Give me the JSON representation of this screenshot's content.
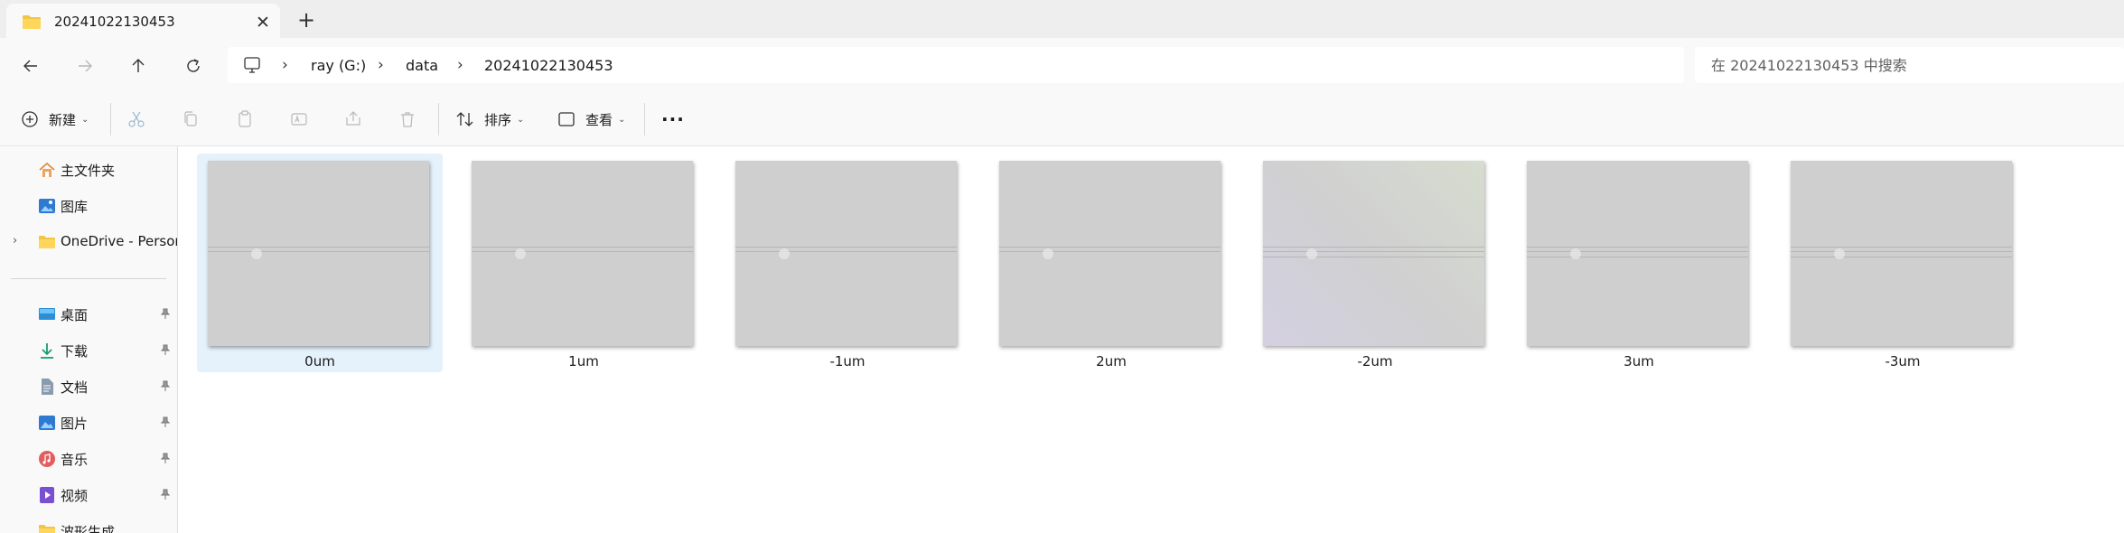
{
  "tab": {
    "title": "20241022130453",
    "close_glyph": "✕",
    "new_tab_glyph": "+"
  },
  "breadcrumb": {
    "separator": "›",
    "items": [
      "ray (G:)",
      "data",
      "20241022130453"
    ]
  },
  "search": {
    "placeholder": "在 20241022130453 中搜索",
    "value": ""
  },
  "commands": {
    "new_label": "新建",
    "sort_label": "排序",
    "view_label": "查看",
    "more_glyph": "···"
  },
  "sidebar": {
    "items": [
      {
        "label": "主文件夹",
        "icon": "home-icon"
      },
      {
        "label": "图库",
        "icon": "gallery-icon"
      },
      {
        "label": "OneDrive - Personal",
        "icon": "folder-icon"
      },
      {
        "label": "桌面",
        "icon": "desktop-icon"
      },
      {
        "label": "下载",
        "icon": "download-icon"
      },
      {
        "label": "文档",
        "icon": "documents-icon"
      },
      {
        "label": "图片",
        "icon": "pictures-icon"
      },
      {
        "label": "音乐",
        "icon": "music-icon"
      },
      {
        "label": "视频",
        "icon": "videos-icon"
      },
      {
        "label": "波形生成",
        "icon": "folder-icon"
      }
    ]
  },
  "files": [
    {
      "name": "0um",
      "selected": true
    },
    {
      "name": "1um",
      "selected": false
    },
    {
      "name": "-1um",
      "selected": false
    },
    {
      "name": "2um",
      "selected": false
    },
    {
      "name": "-2um",
      "selected": false
    },
    {
      "name": "3um",
      "selected": false
    },
    {
      "name": "-3um",
      "selected": false
    }
  ],
  "colors": {
    "accent": "#0067c0",
    "selection": "#e5f1fb",
    "folder": "#f2c544"
  }
}
